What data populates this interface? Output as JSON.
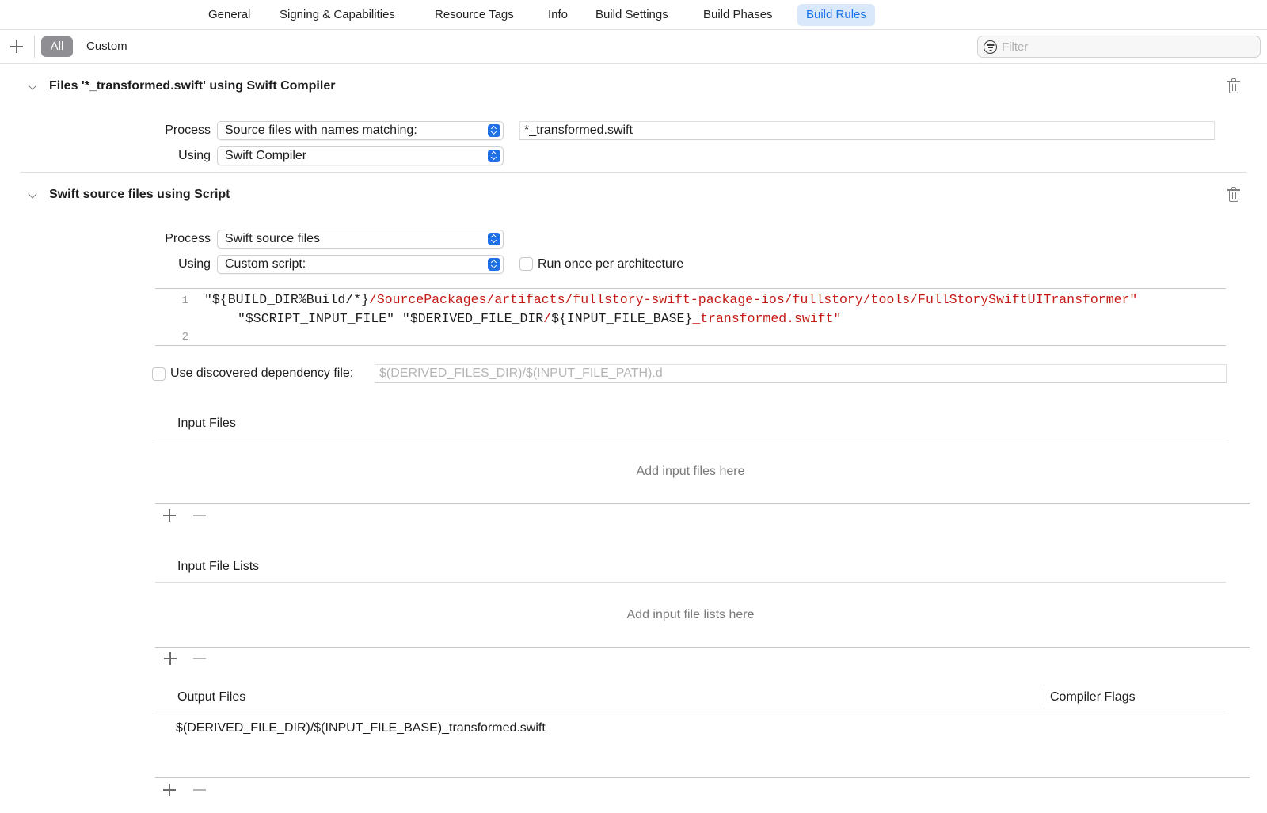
{
  "tabs": [
    {
      "label": "General",
      "active": false
    },
    {
      "label": "Signing & Capabilities",
      "active": false
    },
    {
      "label": "Resource Tags",
      "active": false
    },
    {
      "label": "Info",
      "active": false
    },
    {
      "label": "Build Settings",
      "active": false
    },
    {
      "label": "Build Phases",
      "active": false
    },
    {
      "label": "Build Rules",
      "active": true
    }
  ],
  "filterbar": {
    "segments": [
      "All",
      "Custom"
    ],
    "selected_segment": "All",
    "filter_placeholder": "Filter",
    "filter_value": ""
  },
  "rules": [
    {
      "title": "Files '*_transformed.swift' using Swift Compiler",
      "process_label": "Process",
      "process_value": "Source files with names matching:",
      "pattern_value": "*_transformed.swift",
      "using_label": "Using",
      "using_value": "Swift Compiler"
    },
    {
      "title": "Swift source files using Script",
      "process_label": "Process",
      "process_value": "Swift source files",
      "using_label": "Using",
      "using_value": "Custom script:",
      "run_once_label": "Run once per architecture",
      "run_once_checked": false,
      "script": {
        "line_numbers": [
          "1",
          "2"
        ],
        "line1_part1": "\"${BUILD_DIR%Build/*}",
        "line1_part2": "/SourcePackages/artifacts/fullstory-swift-package-ios/fullstory/tools/FullStorySwiftUITransformer\"",
        "line1b_part1": "\"$SCRIPT_INPUT_FILE\" \"$DERIVED_FILE_DIR",
        "line1b_part2": "/",
        "line1b_part3": "${INPUT_FILE_BASE}",
        "line1b_part4": "_transformed.swift\""
      },
      "dependency_label": "Use discovered dependency file:",
      "dependency_checked": false,
      "dependency_placeholder": "$(DERIVED_FILES_DIR)/$(INPUT_FILE_PATH).d",
      "dependency_value": "",
      "input_files": {
        "title": "Input Files",
        "empty_hint": "Add input files here"
      },
      "input_file_lists": {
        "title": "Input File Lists",
        "empty_hint": "Add input file lists here"
      },
      "output_files": {
        "title": "Output Files",
        "compiler_flags_title": "Compiler Flags",
        "rows": [
          "$(DERIVED_FILE_DIR)/$(INPUT_FILE_BASE)_transformed.swift"
        ]
      }
    }
  ],
  "colors": {
    "accent": "#1f6fe5",
    "active_tab_bg": "#d9e8fb",
    "script_string": "#c41a16"
  }
}
